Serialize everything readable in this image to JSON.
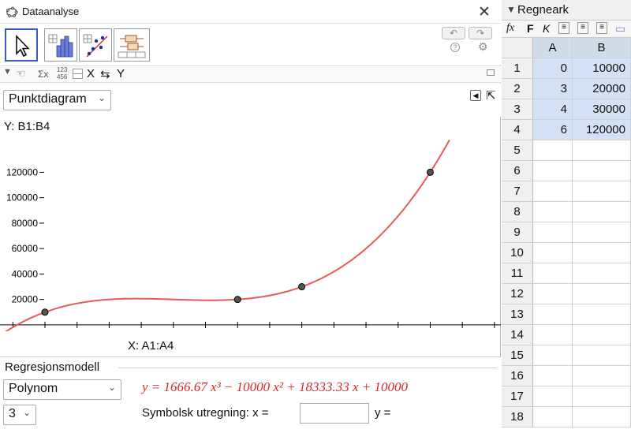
{
  "window": {
    "title": "Dataanalyse",
    "close_glyph": "✕"
  },
  "toolbar": {
    "tools": [
      "select-arrow-icon",
      "histogram-icon",
      "scatter-regression-icon",
      "boxplot-icon"
    ],
    "undo_glyph": "↶",
    "redo_glyph": "↷",
    "help_glyph": "?",
    "settings_glyph": "⚙"
  },
  "options": {
    "sigma_glyph": "Σx",
    "numbers_glyph": "123\n456",
    "swap_x": "X",
    "swap_glyph": "⇆",
    "swap_y": "Y"
  },
  "plot_type": {
    "selected": "Punktdiagram"
  },
  "y_source": "Y:  B1:B4",
  "x_source": "X:  A1:A4",
  "regression": {
    "legend": "Regresjonsmodell",
    "model": "Polynom",
    "degree": "3",
    "formula": "y = 1666.67 x³ − 10000 x² + 18333.33 x + 10000",
    "symbolic_label": "Symbolsk utregning:  x =",
    "x_value": "",
    "y_label": "y ="
  },
  "chart_data": {
    "type": "scatter",
    "title": "",
    "xlabel": "",
    "ylabel": "",
    "xlim": [
      -0.7,
      7.1
    ],
    "ylim": [
      -5000,
      150000
    ],
    "xticks": [
      -0.5,
      0,
      0.5,
      1,
      1.5,
      2,
      2.5,
      3,
      3.5,
      4,
      4.5,
      5,
      5.5,
      6,
      6.5,
      7
    ],
    "yticks": [
      20000,
      40000,
      60000,
      80000,
      100000,
      120000
    ],
    "points": [
      {
        "x": 0,
        "y": 10000
      },
      {
        "x": 3,
        "y": 20000
      },
      {
        "x": 4,
        "y": 30000
      },
      {
        "x": 6,
        "y": 120000
      }
    ],
    "fit": {
      "type": "cubic",
      "coefficients": [
        1666.67,
        -10000,
        18333.33,
        10000
      ],
      "color": "#e85a5a"
    },
    "point_color": "#555555"
  },
  "spreadsheet": {
    "title": "Regneark",
    "tools": [
      "fx",
      "F",
      "K",
      "≡",
      "≡",
      "≡",
      "▭"
    ],
    "columns": [
      "A",
      "B"
    ],
    "rows": [
      {
        "n": "1",
        "a": "0",
        "b": "10000"
      },
      {
        "n": "2",
        "a": "3",
        "b": "20000"
      },
      {
        "n": "3",
        "a": "4",
        "b": "30000"
      },
      {
        "n": "4",
        "a": "6",
        "b": "120000"
      },
      {
        "n": "5",
        "a": "",
        "b": ""
      },
      {
        "n": "6",
        "a": "",
        "b": ""
      },
      {
        "n": "7",
        "a": "",
        "b": ""
      },
      {
        "n": "8",
        "a": "",
        "b": ""
      },
      {
        "n": "9",
        "a": "",
        "b": ""
      },
      {
        "n": "10",
        "a": "",
        "b": ""
      },
      {
        "n": "11",
        "a": "",
        "b": ""
      },
      {
        "n": "12",
        "a": "",
        "b": ""
      },
      {
        "n": "13",
        "a": "",
        "b": ""
      },
      {
        "n": "14",
        "a": "",
        "b": ""
      },
      {
        "n": "15",
        "a": "",
        "b": ""
      },
      {
        "n": "16",
        "a": "",
        "b": ""
      },
      {
        "n": "17",
        "a": "",
        "b": ""
      },
      {
        "n": "18",
        "a": "",
        "b": ""
      }
    ],
    "highlight_color": "#d4e0f5"
  }
}
